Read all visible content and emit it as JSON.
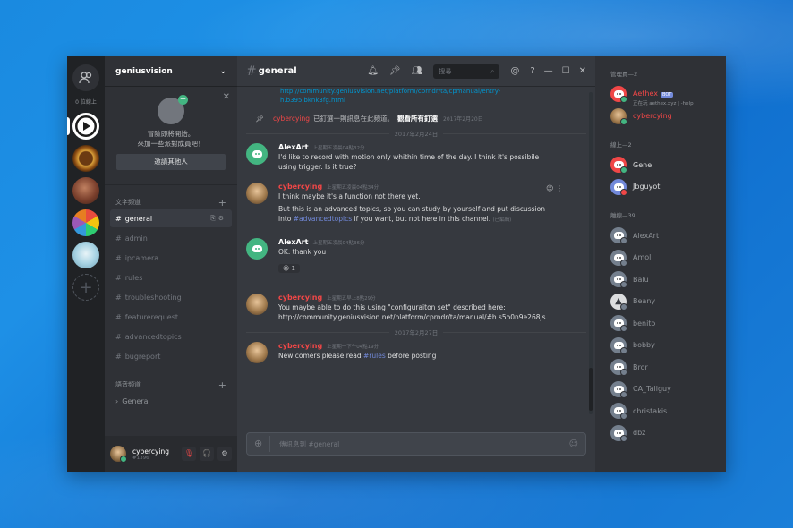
{
  "server_rail": {
    "online_label": "0 位線上"
  },
  "guild": {
    "name": "geniusvision",
    "invite_text_1": "冒險即將開始。",
    "invite_text_2": "來加一些派對成員吧！",
    "invite_button": "邀請其他人"
  },
  "text_category": "文字頻道",
  "voice_category": "語音頻道",
  "channels": [
    "general",
    "admin",
    "ipcamera",
    "rules",
    "troubleshooting",
    "featurerequest",
    "advancedtopics",
    "bugreport"
  ],
  "voice_channels": [
    "General"
  ],
  "user": {
    "name": "cybercying",
    "tag": "#1396"
  },
  "chat": {
    "channel": "general",
    "search_placeholder": "搜尋",
    "top_link_1": "http://community.geniusvision.net/platform/cprndr/ta/cpmanual/entry-",
    "top_link_2": "h.b395ibknk3fg.html",
    "pin": {
      "author": "cybercying",
      "text": "已釘選一則訊息在此頻道。",
      "see_all": "觀看所有釘選",
      "time": "2017年2月20日"
    },
    "date1": "2017年2月24日",
    "date2": "2017年2月27日",
    "msgs": [
      {
        "author": "AlexArt",
        "time": "上星期五凌晨04點32分",
        "line1": "I'd like to record with motion only whithin time of the day. I think it's possibile",
        "line2": "using trigger. Is it true?"
      },
      {
        "author": "cybercying",
        "time": "上星期五凌晨04點34分",
        "line1": "I think maybe it's a function not there yet.",
        "line2": "But this is an advanced topics, so you can study by yourself and put discussion",
        "line3_pre": "into",
        "mention": "#advancedtopics",
        "line3_post": "if you want, but not here in this channel.",
        "edited": "(已編輯)"
      },
      {
        "author": "AlexArt",
        "time": "上星期五凌晨04點36分",
        "line1": "OK. thank you",
        "reaction": "😀 1"
      },
      {
        "author": "cybercying",
        "time": "上星期五早上8點29分",
        "line1": "You maybe able to do this using \"configuraiton set\" described here:",
        "link": "http://community.geniusvision.net/platform/cprndr/ta/manual/#h.s5o0n9e268js"
      },
      {
        "author": "cybercying",
        "time": "上星期一下午04點19分",
        "line1_pre": "New comers please read",
        "mention": "#rules",
        "line1_post": "before posting"
      }
    ],
    "composer_placeholder": "傳訊息到 #general"
  },
  "members": {
    "admins_label": "管理員—2",
    "online_label": "線上—2",
    "offline_label": "離線—39",
    "admins": [
      {
        "name": "Aethex",
        "badge": "BOT",
        "sub": "正在玩 aethex.xyz | -help"
      },
      {
        "name": "cybercying"
      }
    ],
    "online": [
      "Gene",
      "Jbguyot"
    ],
    "offline": [
      "AlexArt",
      "Amol",
      "Balu",
      "Beany",
      "benito",
      "bobby",
      "Bror",
      "CA_Tallguy",
      "christakis",
      "dbz"
    ]
  }
}
